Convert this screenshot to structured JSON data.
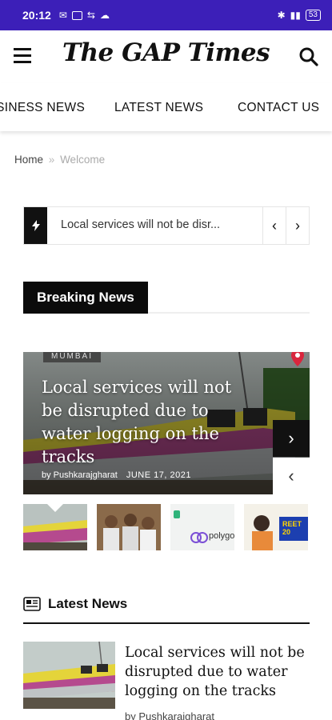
{
  "status_bar": {
    "time": "20:12",
    "battery": "53"
  },
  "header": {
    "logo": "The GAP Times"
  },
  "nav": {
    "items": [
      "BUSINESS NEWS",
      "LATEST NEWS",
      "CONTACT US"
    ]
  },
  "breadcrumb": {
    "home": "Home",
    "separator": "»",
    "current": "Welcome"
  },
  "ticker": {
    "text": "Local services will not be disr...",
    "prev": "‹",
    "next": "›"
  },
  "breaking": {
    "heading": "Breaking News",
    "feature": {
      "category": "MUMBAI",
      "headline": "Local services will not be disrupted due to water logging on the tracks",
      "author": "by Pushkarajgharat",
      "date": "JUNE 17, 2021"
    },
    "thumbs": [
      {
        "label": ""
      },
      {
        "label": ""
      },
      {
        "label": "polygon"
      },
      {
        "label": "REET 20"
      }
    ]
  },
  "latest": {
    "heading": "Latest News",
    "article": {
      "title": "Local services will not be disrupted due to water logging on the tracks",
      "author": "by Pushkarajgharat"
    }
  },
  "colors": {
    "status_bar": "#3c1fb8",
    "accent_dark": "#0b0b0b",
    "pin": "#d9263d"
  }
}
